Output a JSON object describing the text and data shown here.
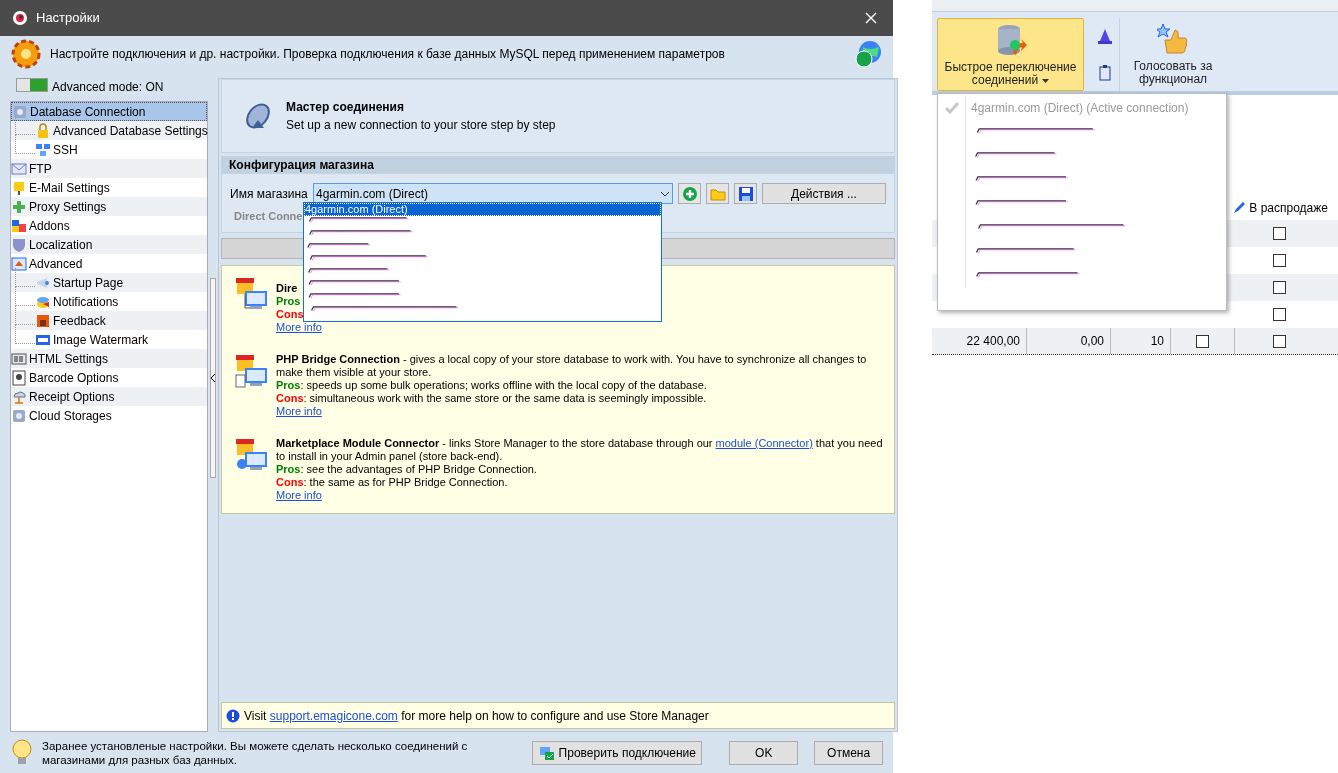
{
  "window": {
    "title": "Настройки"
  },
  "header": {
    "text": "Настройте подключения и др. настройки. Проверка подключения к базе данных MySQL перед применением параметров"
  },
  "advanced_mode": {
    "label": "Advanced mode: ON",
    "on": true
  },
  "sidebar": {
    "items": [
      {
        "label": "Database Connection",
        "selected": true,
        "children": [
          {
            "label": "Advanced Database Settings",
            "selected": false
          },
          {
            "label": "SSH",
            "selected": false
          }
        ]
      },
      {
        "label": "FTP",
        "selected": false
      },
      {
        "label": "E-Mail Settings",
        "selected": false
      },
      {
        "label": "Proxy Settings",
        "selected": false
      },
      {
        "label": "Addons",
        "selected": false
      },
      {
        "label": "Localization",
        "selected": false
      },
      {
        "label": "Advanced",
        "selected": false,
        "children": [
          {
            "label": "Startup Page",
            "selected": false
          },
          {
            "label": "Notifications",
            "selected": false
          },
          {
            "label": "Feedback",
            "selected": false
          },
          {
            "label": "Image Watermark",
            "selected": false
          }
        ]
      },
      {
        "label": "HTML Settings",
        "selected": false
      },
      {
        "label": "Barcode Options",
        "selected": false
      },
      {
        "label": "Receipt Options",
        "selected": false
      },
      {
        "label": "Cloud Storages",
        "selected": false
      }
    ]
  },
  "wizard": {
    "title": "Мастер соединения",
    "subtitle": "Set up a new connection to your store step by step"
  },
  "store_config": {
    "title": "Конфигурация магазина",
    "label": "Имя магазина",
    "value": "4garmin.com (Direct)",
    "actions_button": "Действия ...",
    "type_label": "Direct Conne",
    "options": [
      {
        "label": "4garmin.com (Direct)",
        "selected": true
      },
      {
        "kind": "redacted",
        "selected": false
      },
      {
        "kind": "redacted",
        "selected": false
      },
      {
        "kind": "redacted",
        "selected": false
      },
      {
        "kind": "redacted",
        "selected": false
      },
      {
        "kind": "redacted",
        "selected": false
      },
      {
        "kind": "redacted",
        "selected": false
      },
      {
        "kind": "redacted",
        "selected": false
      },
      {
        "kind": "redacted",
        "selected": false
      }
    ]
  },
  "connections": [
    {
      "description": "**Dire**",
      "pros_label": "Pros",
      "cons_label": "Cons",
      "link": "More info"
    },
    {
      "description": "**PHP Bridge Connection** - gives a local copy of your store database to work with. You have to synchronize all changes to make them visible at your store.",
      "pros_label": "Pros",
      "pros": ": speeds up some bulk operations; works offline with the local copy of the database.",
      "cons_label": "Cons",
      "cons": ": simultaneous work with the same store or the same data is seemingly impossible.",
      "link": "More info"
    },
    {
      "description": "**Marketplace Module Connector** - links Store Manager to the store database through our ",
      "description_link": "module (Connector)",
      "description_after": " that you need to install in your Admin panel (store back-end).",
      "pros_label": "Pros",
      "pros": ": see the advantages of PHP Bridge Connection.",
      "cons_label": "Cons",
      "cons": ": the same as for PHP Bridge Connection.",
      "link": "More info"
    }
  ],
  "support": {
    "before": "Visit ",
    "link": "support.emagicone.com",
    "after": " for more help on how to configure and use Store Manager"
  },
  "footer": {
    "hint": "Заранее установленые настройки. Вы можете сделать несколько соединений с магазинами для разных баз данных.",
    "buttons": [
      "Проверить подключение",
      "OK",
      "Отмена"
    ]
  },
  "right_app": {
    "ribbon": [
      {
        "label": "Быстрое переключение соединений",
        "selected": true
      },
      {
        "label": "Голосовать за функционал",
        "selected": false
      }
    ],
    "quick_menu": [
      {
        "label": "4garmin.com (Direct) (Active connection)",
        "checked": true,
        "disabled": true
      },
      {
        "kind": "redacted"
      },
      {
        "kind": "redacted"
      },
      {
        "kind": "redacted"
      },
      {
        "kind": "redacted"
      },
      {
        "kind": "redacted"
      },
      {
        "kind": "redacted"
      },
      {
        "kind": "redacted"
      }
    ],
    "table": {
      "sale_column": "В распродаже",
      "rows": [
        {
          "on_sale": false
        },
        {
          "on_sale": false
        },
        {
          "on_sale": false
        },
        {
          "on_sale": false
        },
        {
          "column_1": "22 400,00",
          "column_2": "0,00",
          "column_3": "10",
          "column_4": false,
          "on_sale": false
        }
      ]
    }
  }
}
